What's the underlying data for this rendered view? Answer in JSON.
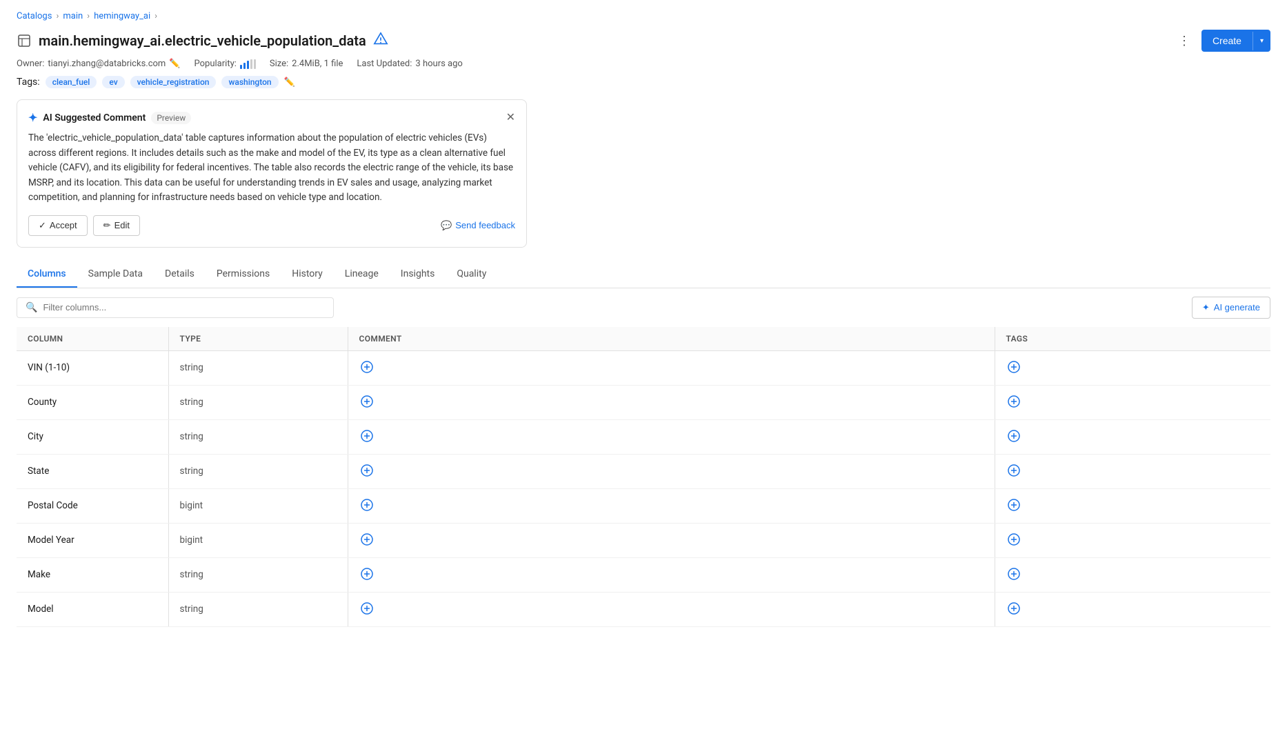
{
  "breadcrumb": {
    "items": [
      {
        "label": "Catalogs",
        "href": "#"
      },
      {
        "label": "main",
        "href": "#"
      },
      {
        "label": "hemingway_ai",
        "href": "#"
      }
    ]
  },
  "header": {
    "icon": "table",
    "title": "main.hemingway_ai.electric_vehicle_population_data",
    "alert_title": "alert",
    "more_label": "⋮",
    "create_label": "Create",
    "create_chevron": "▾"
  },
  "meta": {
    "owner_label": "Owner:",
    "owner_value": "tianyi.zhang@databricks.com",
    "popularity_label": "Popularity:",
    "size_label": "Size:",
    "size_value": "2.4MiB, 1 file",
    "updated_label": "Last Updated:",
    "updated_value": "3 hours ago"
  },
  "tags": {
    "label": "Tags:",
    "items": [
      "clean_fuel",
      "ev",
      "vehicle_registration",
      "washington"
    ]
  },
  "ai_card": {
    "title": "AI Suggested Comment",
    "preview_label": "Preview",
    "body": "The 'electric_vehicle_population_data' table captures information about the population of electric vehicles (EVs) across different regions. It includes details such as the make and model of the EV, its type as a clean alternative fuel vehicle (CAFV), and its eligibility for federal incentives. The table also records the electric range of the vehicle, its base MSRP, and its location. This data can be useful for understanding trends in EV sales and usage, analyzing market competition, and planning for infrastructure needs based on vehicle type and location.",
    "accept_label": "Accept",
    "edit_label": "Edit",
    "feedback_label": "Send feedback"
  },
  "tabs": {
    "items": [
      "Columns",
      "Sample Data",
      "Details",
      "Permissions",
      "History",
      "Lineage",
      "Insights",
      "Quality"
    ],
    "active": "Columns"
  },
  "filter": {
    "placeholder": "Filter columns...",
    "ai_generate_label": "AI generate"
  },
  "table": {
    "columns": [
      "Column",
      "Type",
      "Comment",
      "Tags"
    ],
    "rows": [
      {
        "name": "VIN (1-10)",
        "type": "string"
      },
      {
        "name": "County",
        "type": "string"
      },
      {
        "name": "City",
        "type": "string"
      },
      {
        "name": "State",
        "type": "string"
      },
      {
        "name": "Postal Code",
        "type": "bigint"
      },
      {
        "name": "Model Year",
        "type": "bigint"
      },
      {
        "name": "Make",
        "type": "string"
      },
      {
        "name": "Model",
        "type": "string"
      }
    ]
  }
}
